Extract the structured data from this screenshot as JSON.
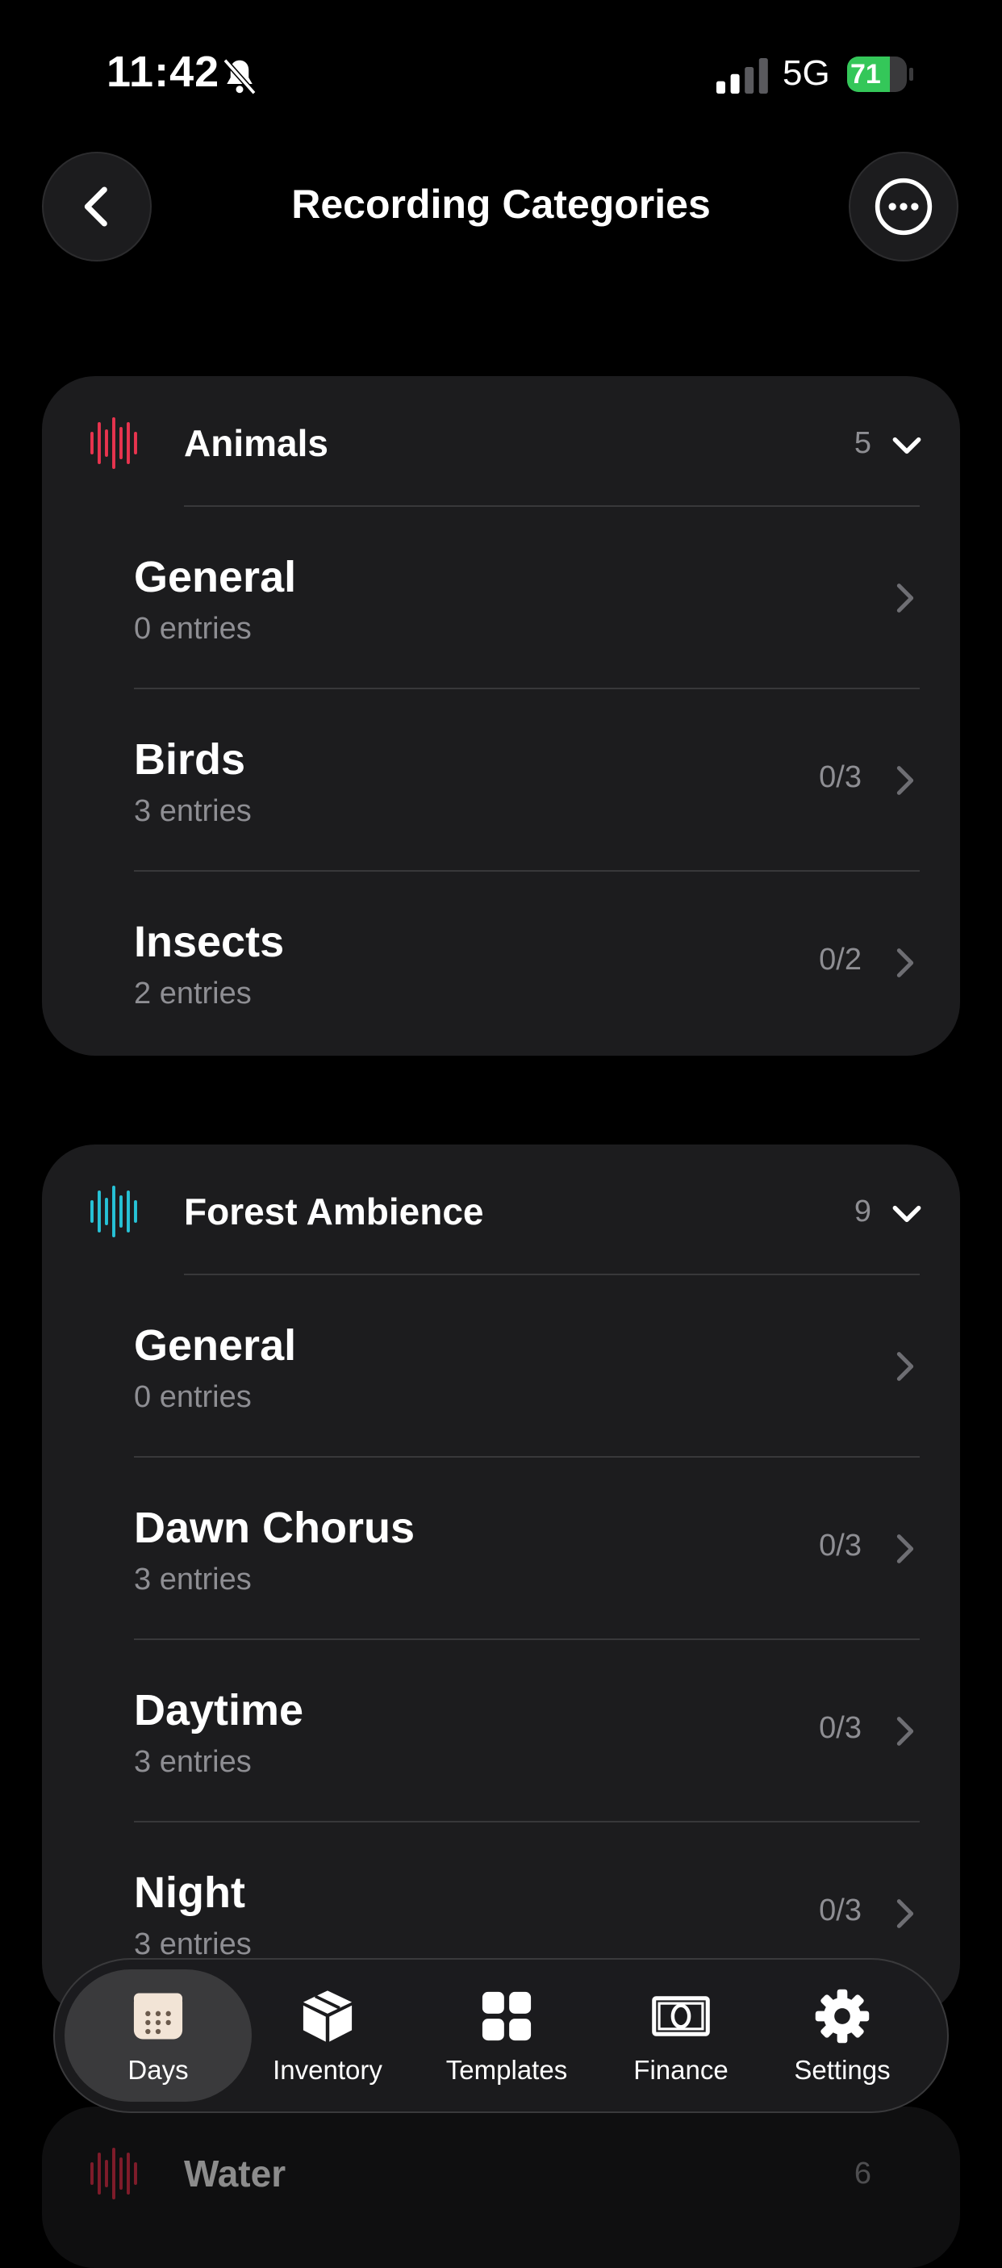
{
  "status_bar": {
    "time": "11:42",
    "network": "5G",
    "battery": "71",
    "battery_level": 0.71,
    "battery_color": "#34c759"
  },
  "header": {
    "title": "Recording Categories",
    "back_icon": "chevron-left-icon",
    "more_icon": "ellipsis-circle-icon"
  },
  "categories": [
    {
      "name": "Animals",
      "count": "5",
      "color": "#e8344e",
      "items": [
        {
          "name": "General",
          "sub": "0 entries",
          "progress": ""
        },
        {
          "name": "Birds",
          "sub": "3 entries",
          "progress": "0/3"
        },
        {
          "name": "Insects",
          "sub": "2 entries",
          "progress": "0/2"
        }
      ]
    },
    {
      "name": "Forest Ambience",
      "count": "9",
      "color": "#27c2d6",
      "items": [
        {
          "name": "General",
          "sub": "0 entries",
          "progress": ""
        },
        {
          "name": "Dawn Chorus",
          "sub": "3 entries",
          "progress": "0/3"
        },
        {
          "name": "Daytime",
          "sub": "3 entries",
          "progress": "0/3"
        },
        {
          "name": "Night",
          "sub": "3 entries",
          "progress": "0/3"
        }
      ]
    },
    {
      "name": "Water",
      "count": "6",
      "color": "#e8344e",
      "items": []
    }
  ],
  "tab_bar": {
    "active": "Days",
    "tabs": [
      {
        "label": "Days",
        "icon": "calendar-icon"
      },
      {
        "label": "Inventory",
        "icon": "box-icon"
      },
      {
        "label": "Templates",
        "icon": "grid-icon"
      },
      {
        "label": "Finance",
        "icon": "banknote-icon"
      },
      {
        "label": "Settings",
        "icon": "gear-icon"
      }
    ]
  }
}
